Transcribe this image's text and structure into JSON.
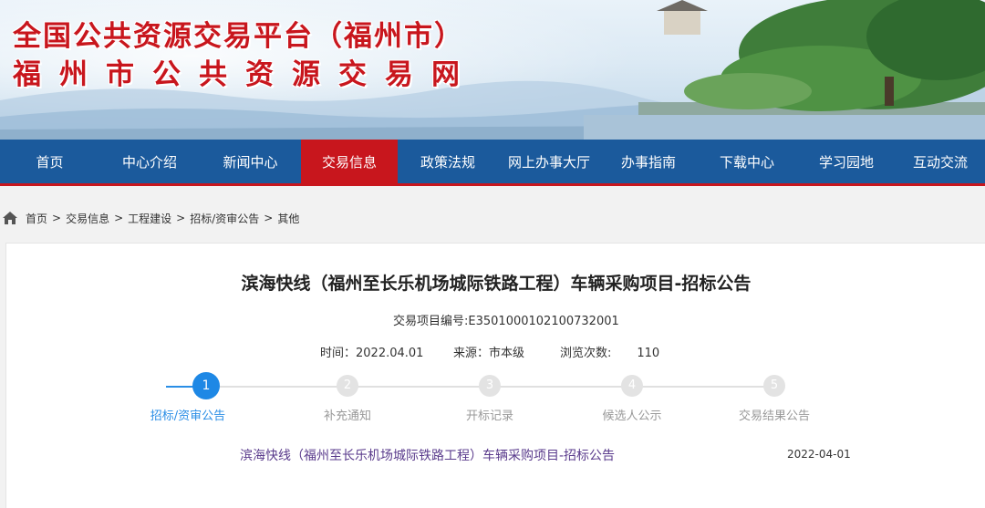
{
  "header": {
    "title_line1": "全国公共资源交易平台（福州市）",
    "title_line2": "福州市公共资源交易网"
  },
  "nav": {
    "items": [
      {
        "label": "首页",
        "active": false
      },
      {
        "label": "中心介绍",
        "active": false
      },
      {
        "label": "新闻中心",
        "active": false
      },
      {
        "label": "交易信息",
        "active": true
      },
      {
        "label": "政策法规",
        "active": false
      },
      {
        "label": "网上办事大厅",
        "active": false
      },
      {
        "label": "办事指南",
        "active": false
      },
      {
        "label": "下载中心",
        "active": false
      },
      {
        "label": "学习园地",
        "active": false
      },
      {
        "label": "互动交流",
        "active": false
      }
    ],
    "bg_color": "#1b5a9c",
    "active_color": "#c8161d"
  },
  "breadcrumb": {
    "icon": "home-icon",
    "items": [
      "首页",
      "交易信息",
      "工程建设",
      "招标/资审公告",
      "其他"
    ],
    "separator": ">"
  },
  "article": {
    "title": "滨海快线（福州至长乐机场城际铁路工程）车辆采购项目-招标公告",
    "code_label": "交易项目编号:",
    "code_value": "E3501000102100732001",
    "time_label": "时间：",
    "time_value": "2022.04.01",
    "source_label": "来源：",
    "source_value": "市本级",
    "views_label": "浏览次数:",
    "views_value": "110"
  },
  "steps": {
    "active_index": 0,
    "items": [
      {
        "number": "1",
        "label": "招标/资审公告"
      },
      {
        "number": "2",
        "label": "补充通知"
      },
      {
        "number": "3",
        "label": "开标记录"
      },
      {
        "number": "4",
        "label": "候选人公示"
      },
      {
        "number": "5",
        "label": "交易结果公告"
      }
    ],
    "active_color": "#1e88e5"
  },
  "list": [
    {
      "title": "滨海快线（福州至长乐机场城际铁路工程）车辆采购项目-招标公告",
      "date": "2022-04-01"
    }
  ]
}
